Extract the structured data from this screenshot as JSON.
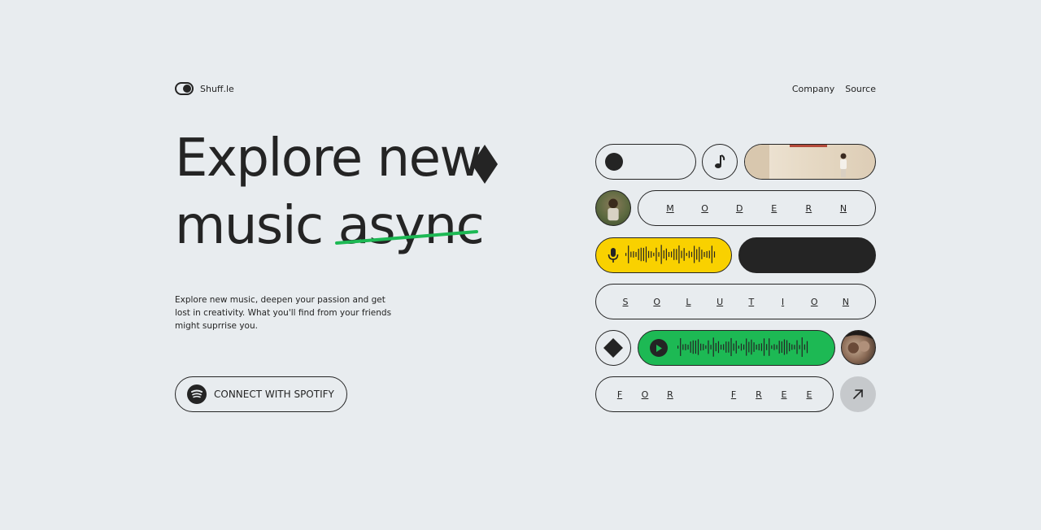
{
  "header": {
    "logo_text": "Shuff.le",
    "nav": [
      "Company",
      "Source"
    ]
  },
  "hero": {
    "line1": "Explore new",
    "line2_word1": "music",
    "line2_word2": "async",
    "description": "Explore new music, deepen your passion and get lost in creativity. What you'll find from your friends might suprrise you.",
    "cta_label": "CONNECT WITH SPOTIFY"
  },
  "tiles": {
    "modern_letters": [
      "M",
      "O",
      "D",
      "E",
      "R",
      "N"
    ],
    "solution_letters": [
      "S",
      "O",
      "L",
      "U",
      "T",
      "I",
      "O",
      "N"
    ],
    "free_letters_1": [
      "F",
      "O",
      "R"
    ],
    "free_letters_2": [
      "F",
      "R",
      "E",
      "E"
    ]
  },
  "colors": {
    "background": "#e8ecef",
    "ink": "#242424",
    "spotify_green": "#1db954",
    "voice_yellow": "#f9d100",
    "arrow_bg": "#c6c9cc"
  },
  "icons": {
    "logo": "toggle-icon",
    "diamond": "diamond-icon",
    "note": "music-note-icon",
    "mic": "microphone-icon",
    "play": "play-icon",
    "arrow": "arrow-up-right-icon",
    "spotify": "spotify-icon"
  }
}
